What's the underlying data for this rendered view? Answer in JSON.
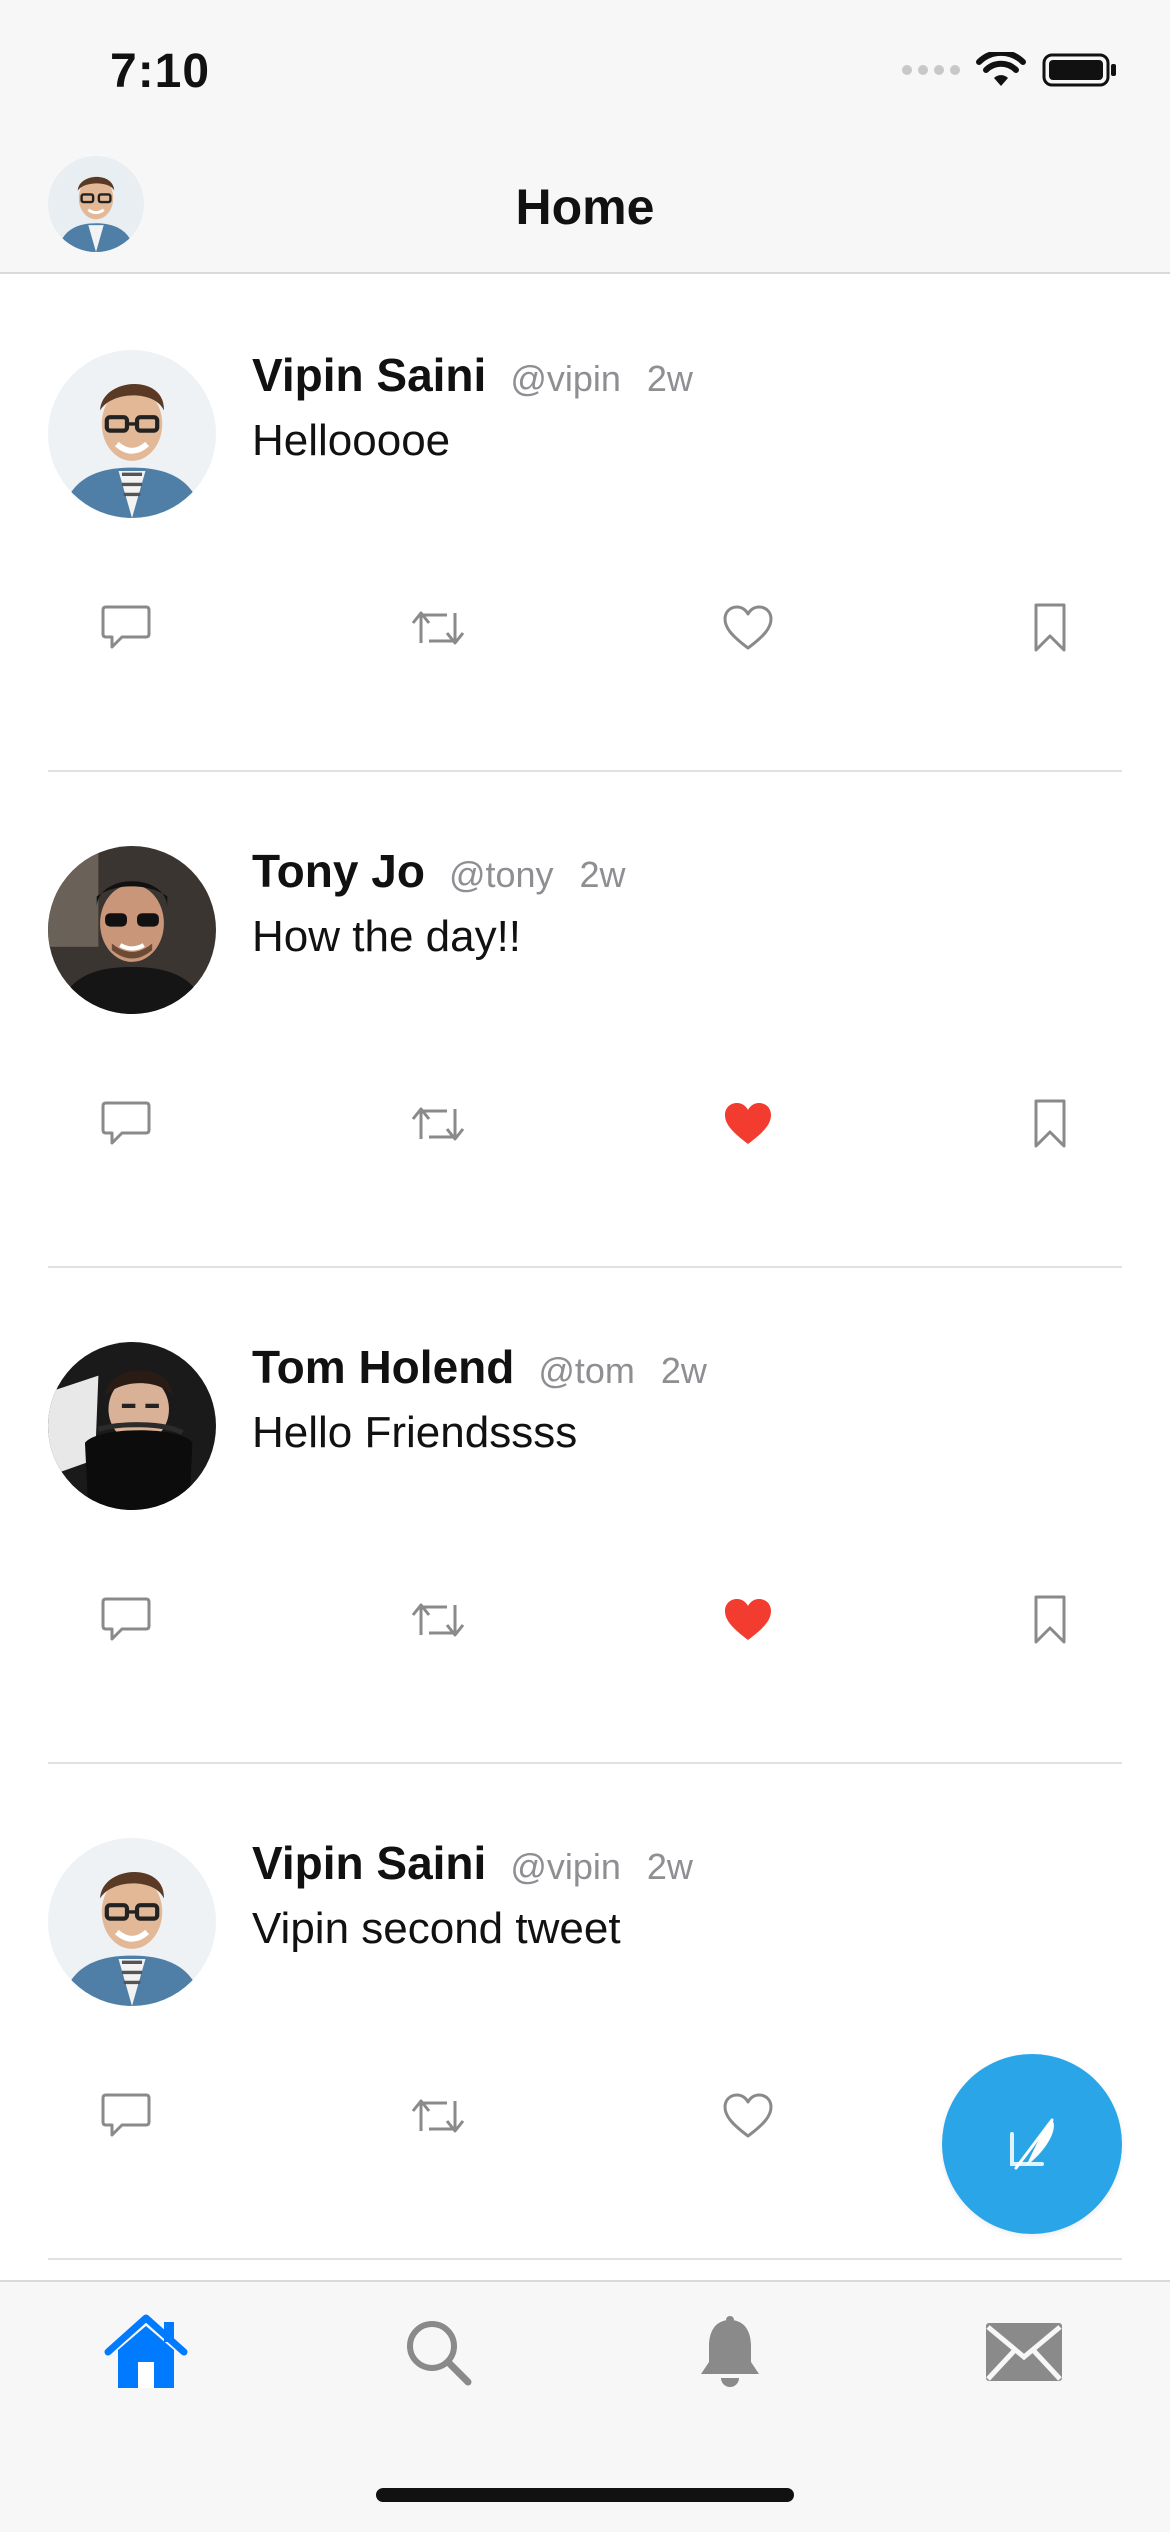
{
  "status_bar": {
    "time": "7:10"
  },
  "nav": {
    "title": "Home"
  },
  "tweets": [
    {
      "name": "Vipin Saini",
      "handle": "@vipin",
      "time": "2w",
      "text": "Hellooooe",
      "liked": false,
      "avatar": "vipin"
    },
    {
      "name": "Tony Jo",
      "handle": "@tony",
      "time": "2w",
      "text": "How the day!!",
      "liked": true,
      "avatar": "tony"
    },
    {
      "name": "Tom Holend",
      "handle": "@tom",
      "time": "2w",
      "text": "Hello Friendssss",
      "liked": true,
      "avatar": "tom"
    },
    {
      "name": "Vipin Saini",
      "handle": "@vipin",
      "time": "2w",
      "text": "Vipin second tweet",
      "liked": false,
      "avatar": "vipin"
    }
  ],
  "icons": {
    "reply": "comment-icon",
    "retweet": "retweet-icon",
    "like": "heart-icon",
    "bookmark": "bookmark-icon",
    "compose": "feather-compose-icon",
    "tabs": [
      "home-icon",
      "search-icon",
      "bell-icon",
      "envelope-icon"
    ]
  },
  "tab_bar": {
    "active": "home"
  },
  "colors": {
    "accent": "#007aff",
    "fab": "#2aa6e8",
    "like_active": "#f13c2f",
    "muted": "#8e8e93",
    "icon_gray": "#8a8a8a"
  }
}
